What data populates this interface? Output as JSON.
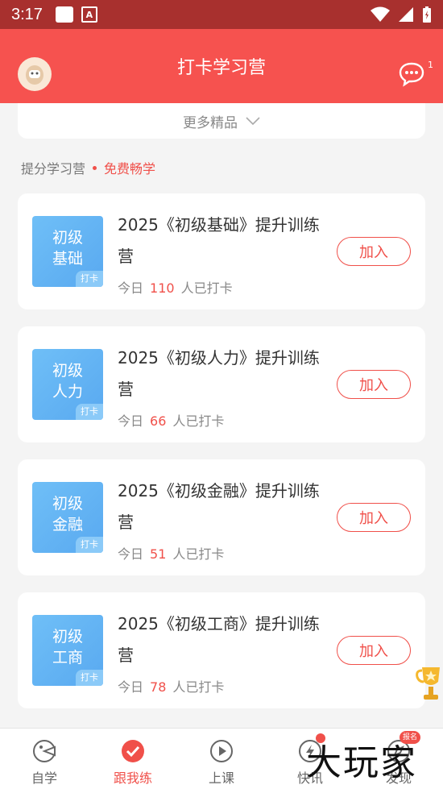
{
  "status_bar": {
    "time": "3:17",
    "icons": [
      "notification-square-icon",
      "font-a-icon",
      "wifi-icon",
      "signal-icon",
      "battery-icon"
    ],
    "a_glyph": "A"
  },
  "header": {
    "title": "打卡学习营",
    "message_count": "1",
    "background": "#f6524f"
  },
  "more": {
    "label": "更多精品"
  },
  "section": {
    "title": "提分学习营",
    "subtitle": "免费畅学"
  },
  "camps": [
    {
      "thumb_line1": "初级",
      "thumb_line2": "基础",
      "tag": "打卡",
      "title": "2025《初级基础》提升训练营",
      "stat_prefix": "今日",
      "count": "110",
      "stat_suffix": "人已打卡",
      "button": "加入"
    },
    {
      "thumb_line1": "初级",
      "thumb_line2": "人力",
      "tag": "打卡",
      "title": "2025《初级人力》提升训练营",
      "stat_prefix": "今日",
      "count": "66",
      "stat_suffix": "人已打卡",
      "button": "加入"
    },
    {
      "thumb_line1": "初级",
      "thumb_line2": "金融",
      "tag": "打卡",
      "title": "2025《初级金融》提升训练营",
      "stat_prefix": "今日",
      "count": "51",
      "stat_suffix": "人已打卡",
      "button": "加入"
    },
    {
      "thumb_line1": "初级",
      "thumb_line2": "工商",
      "tag": "打卡",
      "title": "2025《初级工商》提升训练营",
      "stat_prefix": "今日",
      "count": "78",
      "stat_suffix": "人已打卡",
      "button": "加入"
    }
  ],
  "nav": [
    {
      "label": "自学",
      "icon": "self-study-icon"
    },
    {
      "label": "跟我练",
      "icon": "practice-icon",
      "active": true
    },
    {
      "label": "上课",
      "icon": "play-icon"
    },
    {
      "label": "快讯",
      "icon": "news-icon"
    },
    {
      "label": "发现",
      "icon": "discover-icon",
      "badge": "报名"
    }
  ],
  "watermark": "大玩家",
  "colors": {
    "accent": "#f0504a",
    "thumb_blue": "#5aaaf1",
    "status_bar": "#a8302e"
  }
}
